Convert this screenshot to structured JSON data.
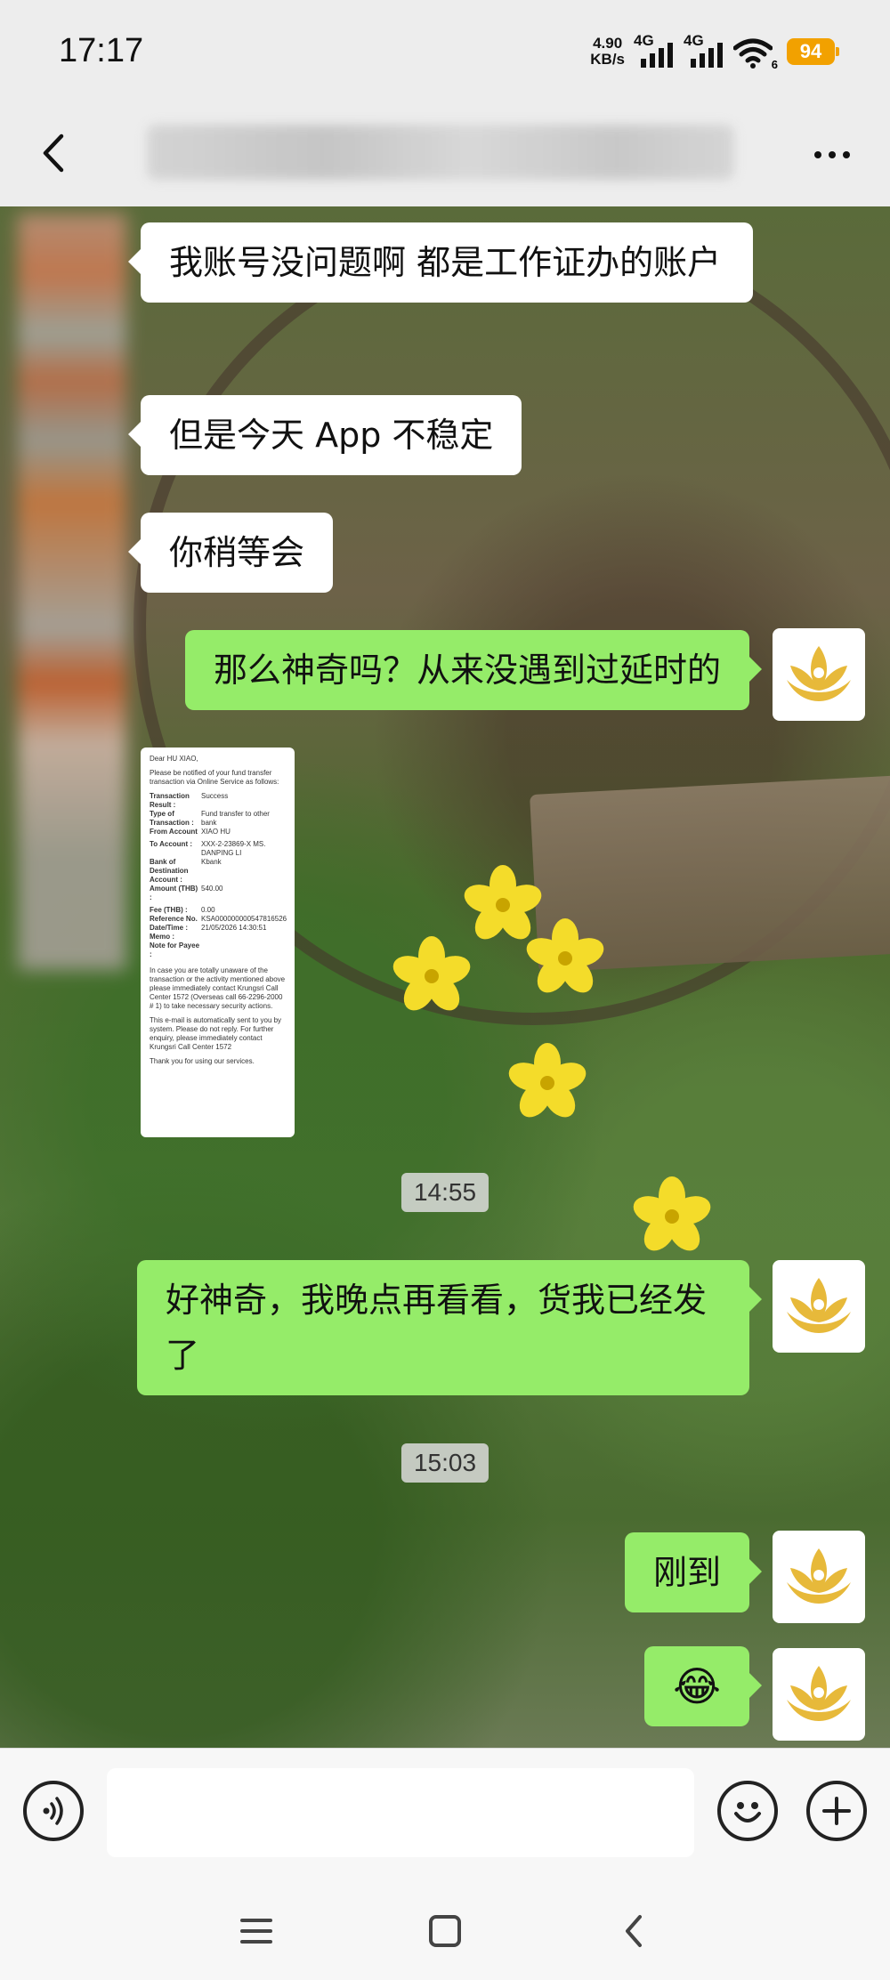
{
  "status": {
    "time": "17:17",
    "net_speed_value": "4.90",
    "net_speed_unit": "KB/s",
    "sim1_label": "4G",
    "sim2_label": "4G",
    "wifi_label": "6",
    "battery": "94"
  },
  "chat": {
    "messages": [
      {
        "side": "in",
        "text": "我账号没问题啊 都是工作证办的账户"
      },
      {
        "side": "in",
        "text": "但是今天 App 不稳定"
      },
      {
        "side": "in",
        "text": "你稍等会"
      },
      {
        "side": "out",
        "text": "那么神奇吗？从来没遇到过延时的"
      },
      {
        "side": "out",
        "text": "好神奇，我晚点再看看，货我已经发了"
      },
      {
        "side": "out",
        "text": "刚到"
      },
      {
        "side": "out",
        "text": "😂"
      }
    ],
    "timestamps": [
      "14:55",
      "15:03"
    ],
    "receipt": {
      "greeting": "Dear HU XIAO,",
      "intro": "Please be notified of your fund transfer transaction via Online Service as follows:",
      "rows": [
        {
          "k": "Transaction Result :",
          "v": "Success"
        },
        {
          "k": "Type of Transaction :",
          "v": "Fund transfer to other bank"
        },
        {
          "k": "From Account",
          "v": "XIAO HU"
        },
        {
          "k": "To Account :",
          "v": "XXX-2-23869-X MS. DANPING LI"
        },
        {
          "k": "Bank of Destination Account :",
          "v": "Kbank"
        },
        {
          "k": "Amount (THB) :",
          "v": "540.00"
        },
        {
          "k": "Fee (THB) :",
          "v": "0.00"
        },
        {
          "k": "Reference No.",
          "v": "KSA000000000547816526"
        },
        {
          "k": "Date/Time :",
          "v": "21/05/2026 14:30:51"
        },
        {
          "k": "Memo :",
          "v": ""
        },
        {
          "k": "Note for Payee :",
          "v": ""
        }
      ],
      "notice1": "In case you are totally unaware of the transaction or the activity mentioned above please immediately contact Krungsri Call Center 1572 (Overseas call 66-2296-2000 # 1) to take necessary security actions.",
      "notice2": "This e-mail is automatically sent to you by system. Please do not reply. For further enquiry, please immediately contact Krungsri Call Center 1572",
      "thanks": "Thank you for using our services."
    }
  },
  "icons": {
    "back": "back-chevron-icon",
    "more": "more-dots-icon",
    "voice": "voice-icon",
    "emoji": "emoji-icon",
    "add": "add-icon"
  },
  "colors": {
    "outgoing_bubble": "#95ec69",
    "incoming_bubble": "#ffffff",
    "battery": "#f2a100"
  }
}
